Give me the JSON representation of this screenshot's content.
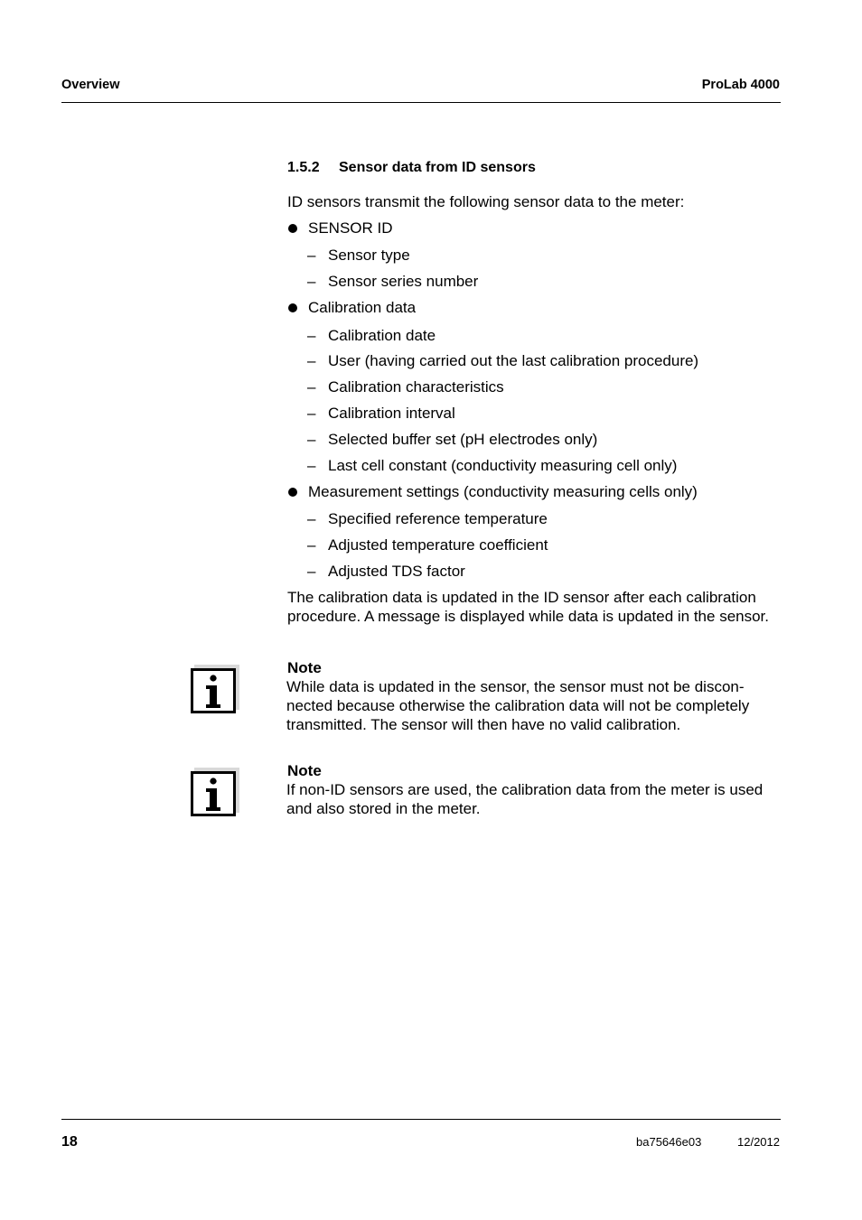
{
  "header": {
    "section": "Overview",
    "product": "ProLab 4000"
  },
  "section": {
    "number": "1.5.2",
    "title": "Sensor data from ID sensors",
    "intro": "ID sensors transmit the following sensor data to the meter:",
    "bullets": [
      {
        "label": "SENSOR ID",
        "items": [
          "Sensor type",
          "Sensor series number"
        ]
      },
      {
        "label": "Calibration data",
        "items": [
          "Calibration date",
          "User (having carried out the last calibration procedure)",
          "Calibration characteristics",
          "Calibration interval",
          "Selected buffer set (pH electrodes only)",
          "Last cell constant (conductivity measuring cell only)"
        ]
      },
      {
        "label": "Measurement settings (conductivity measuring cells only)",
        "items": [
          "Specified reference temperature",
          "Adjusted temperature coefficient",
          "Adjusted TDS factor"
        ]
      }
    ],
    "closing_line1": "The calibration data is updated in the ID sensor after each calibration",
    "closing_line2": "procedure. A message is displayed while data is updated in the sensor."
  },
  "notes": [
    {
      "icon": "info-icon",
      "title": "Note",
      "lines": [
        "While data is updated in the sensor, the sensor must not be discon-",
        "nected because otherwise the calibration data will not be completely",
        "transmitted. The sensor will then have no valid calibration."
      ]
    },
    {
      "icon": "info-icon",
      "title": "Note",
      "lines": [
        "If non-ID sensors are used, the calibration data from the meter is used",
        "and also stored in the meter."
      ]
    }
  ],
  "footer": {
    "page_number": "18",
    "doc_id": "ba75646e03",
    "date": "12/2012"
  }
}
